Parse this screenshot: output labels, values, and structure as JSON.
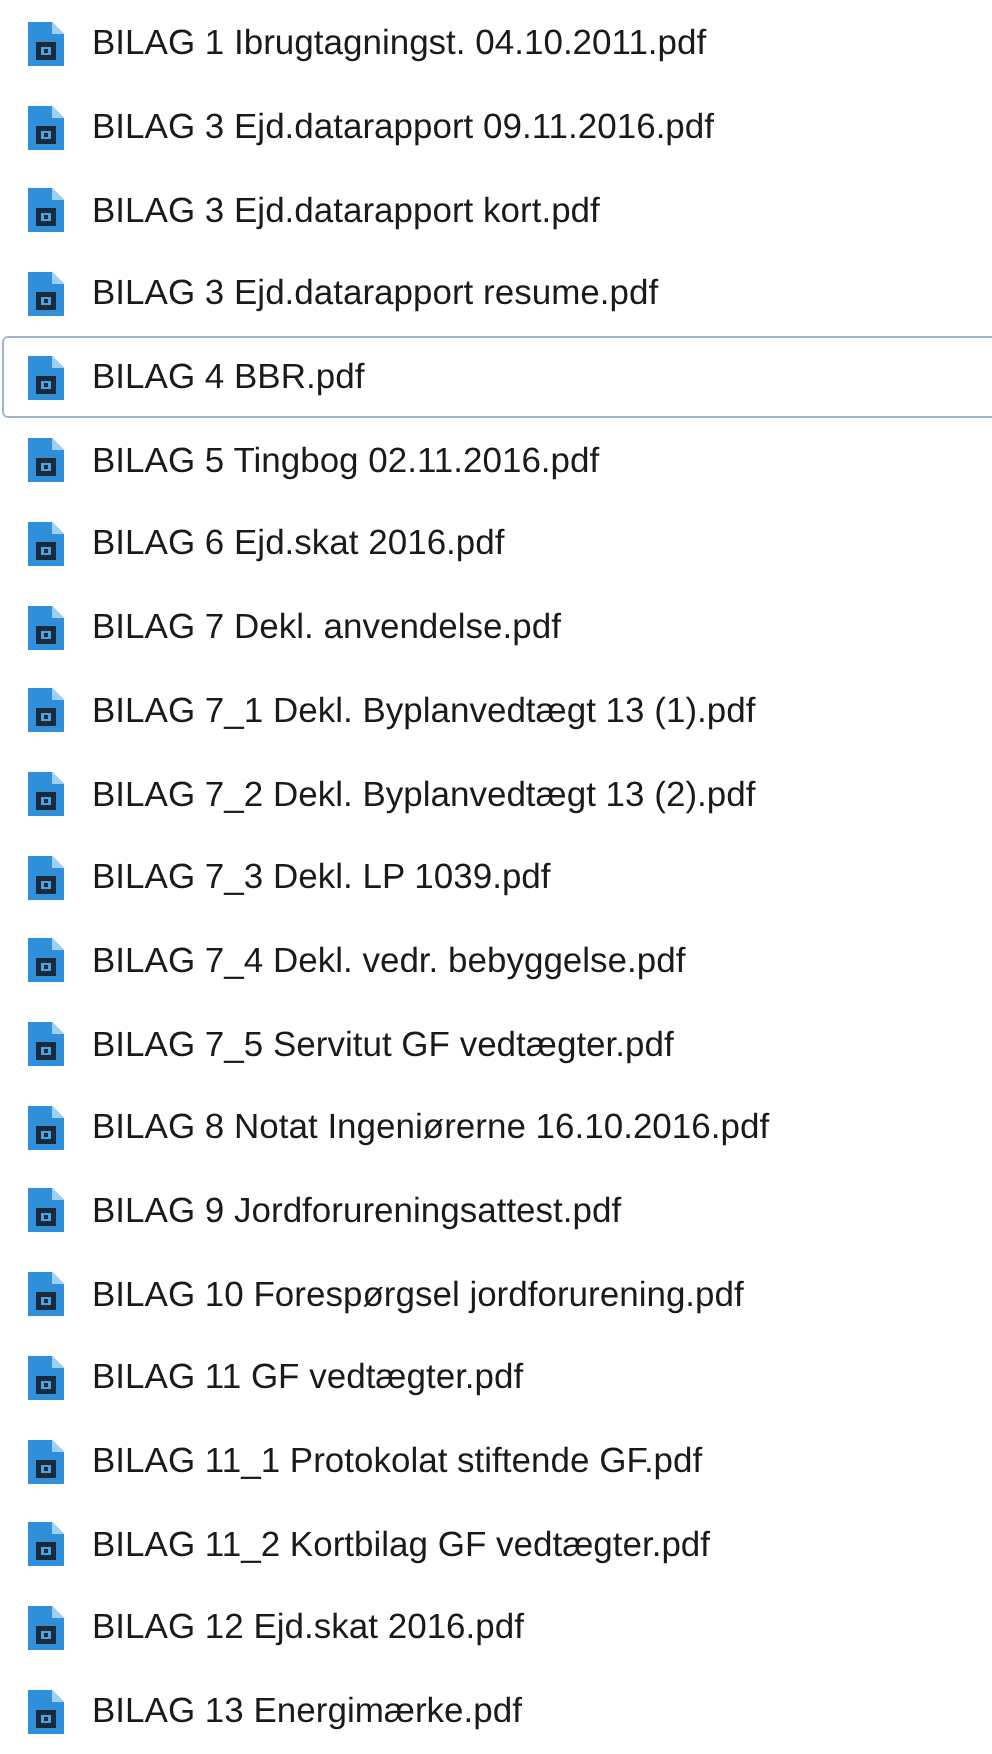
{
  "files": [
    {
      "name": "BILAG 1 Ibrugtagningst. 04.10.2011.pdf",
      "focused": false
    },
    {
      "name": "BILAG 3 Ejd.datarapport 09.11.2016.pdf",
      "focused": false
    },
    {
      "name": "BILAG 3 Ejd.datarapport kort.pdf",
      "focused": false
    },
    {
      "name": "BILAG 3 Ejd.datarapport resume.pdf",
      "focused": false
    },
    {
      "name": "BILAG 4 BBR.pdf",
      "focused": true
    },
    {
      "name": "BILAG 5 Tingbog 02.11.2016.pdf",
      "focused": false
    },
    {
      "name": "BILAG 6 Ejd.skat 2016.pdf",
      "focused": false
    },
    {
      "name": "BILAG 7 Dekl. anvendelse.pdf",
      "focused": false
    },
    {
      "name": "BILAG 7_1 Dekl. Byplanvedtægt 13 (1).pdf",
      "focused": false
    },
    {
      "name": "BILAG 7_2 Dekl. Byplanvedtægt 13 (2).pdf",
      "focused": false
    },
    {
      "name": "BILAG 7_3 Dekl. LP 1039.pdf",
      "focused": false
    },
    {
      "name": "BILAG 7_4 Dekl. vedr. bebyggelse.pdf",
      "focused": false
    },
    {
      "name": "BILAG 7_5 Servitut GF vedtægter.pdf",
      "focused": false
    },
    {
      "name": "BILAG 8 Notat Ingeniørerne 16.10.2016.pdf",
      "focused": false
    },
    {
      "name": "BILAG 9 Jordforureningsattest.pdf",
      "focused": false
    },
    {
      "name": "BILAG 10 Forespørgsel jordforurening.pdf",
      "focused": false
    },
    {
      "name": "BILAG 11 GF vedtægter.pdf",
      "focused": false
    },
    {
      "name": "BILAG 11_1 Protokolat stiftende GF.pdf",
      "focused": false
    },
    {
      "name": "BILAG 11_2 Kortbilag GF vedtægter.pdf",
      "focused": false
    },
    {
      "name": "BILAG 12 Ejd.skat 2016.pdf",
      "focused": false
    },
    {
      "name": "BILAG 13 Energimærke.pdf",
      "focused": false
    }
  ]
}
